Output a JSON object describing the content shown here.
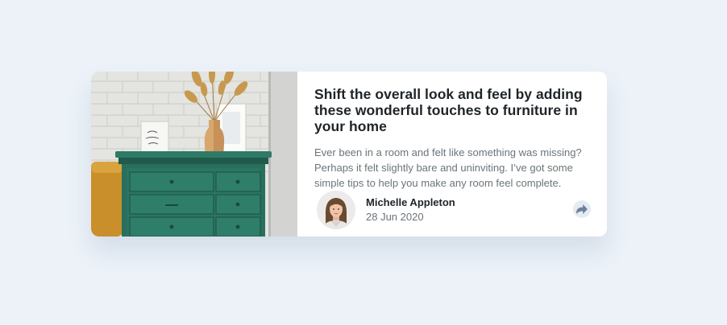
{
  "article": {
    "title": "Shift the overall look and feel by adding these wonderful touches to furniture in your home",
    "description": "Ever been in a room and felt like something was missing? Perhaps it felt slightly bare and uninviting. I’ve got some simple tips to help you make any room feel complete.",
    "image_icon": "drawers-photo"
  },
  "author": {
    "name": "Michelle Appleton",
    "date": "28 Jun 2020",
    "avatar_icon": "avatar-photo"
  },
  "share": {
    "icon": "share-icon"
  },
  "colors": {
    "background": "#ecf2f8",
    "card": "#ffffff",
    "title": "#1f2428",
    "text": "#6b747a",
    "share_bg": "#e5ebf2",
    "share_icon": "#6e8098"
  }
}
